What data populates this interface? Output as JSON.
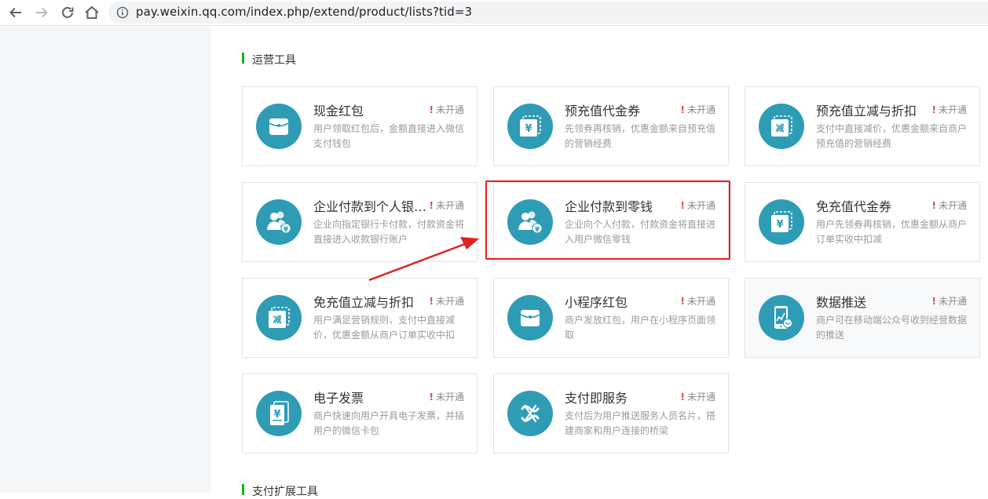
{
  "browser": {
    "url": "pay.weixin.qq.com/index.php/extend/product/lists?tid=3"
  },
  "sections": {
    "ops": {
      "title": "运营工具"
    },
    "ext": {
      "title": "支付扩展工具"
    }
  },
  "cards": [
    {
      "name": "现金红包",
      "status": "未开通",
      "desc": "用户领取红包后，金额直接进入微信支付钱包",
      "icon": "red-envelope-icon"
    },
    {
      "name": "预充值代金券",
      "status": "未开通",
      "desc": "先领券再核销，优惠金额来自预充值的营销经费",
      "icon": "yuan-coupon-icon"
    },
    {
      "name": "预充值立减与折扣",
      "status": "未开通",
      "desc": "支付中直接减价，优惠金额来自商户预充值的营销经费",
      "icon": "discount-coupon-icon"
    },
    {
      "name": "企业付款到个人银…",
      "status": "未开通",
      "desc": "企业向指定银行卡付款，付款资金将直接进入收款银行账户",
      "icon": "users-yuan-icon"
    },
    {
      "name": "企业付款到零钱",
      "status": "未开通",
      "desc": "企业向个人付款，付款资金将直接进入用户微信零钱",
      "icon": "users-yuan-icon"
    },
    {
      "name": "免充值代金券",
      "status": "未开通",
      "desc": "用户先领券再核销，优惠金额从商户订单实收中扣减",
      "icon": "yuan-coupon-icon"
    },
    {
      "name": "免充值立减与折扣",
      "status": "未开通",
      "desc": "用户满足营销规则，支付中直接减价，优惠金额从商户订单实收中扣",
      "icon": "discount-coupon-icon"
    },
    {
      "name": "小程序红包",
      "status": "未开通",
      "desc": "商户发放红包，用户在小程序页面领取",
      "icon": "red-envelope-icon"
    },
    {
      "name": "数据推送",
      "status": "未开通",
      "desc": "商户可在移动端公众号收到经营数据的推送",
      "icon": "phone-chart-icon"
    },
    {
      "name": "电子发票",
      "status": "未开通",
      "desc": "商户快速向用户开具电子发票，并插用户的微信卡包",
      "icon": "invoice-icon"
    },
    {
      "name": "支付即服务",
      "status": "未开通",
      "desc": "支付后为用户推送服务人员名片，搭建商家和用户连接的桥梁",
      "icon": "service-link-icon"
    }
  ],
  "annotation": {
    "color": "#e02020"
  },
  "colors": {
    "icon_bg": "#2f9cb6",
    "accent_green": "#1aad19",
    "warning_red": "#e64340"
  }
}
